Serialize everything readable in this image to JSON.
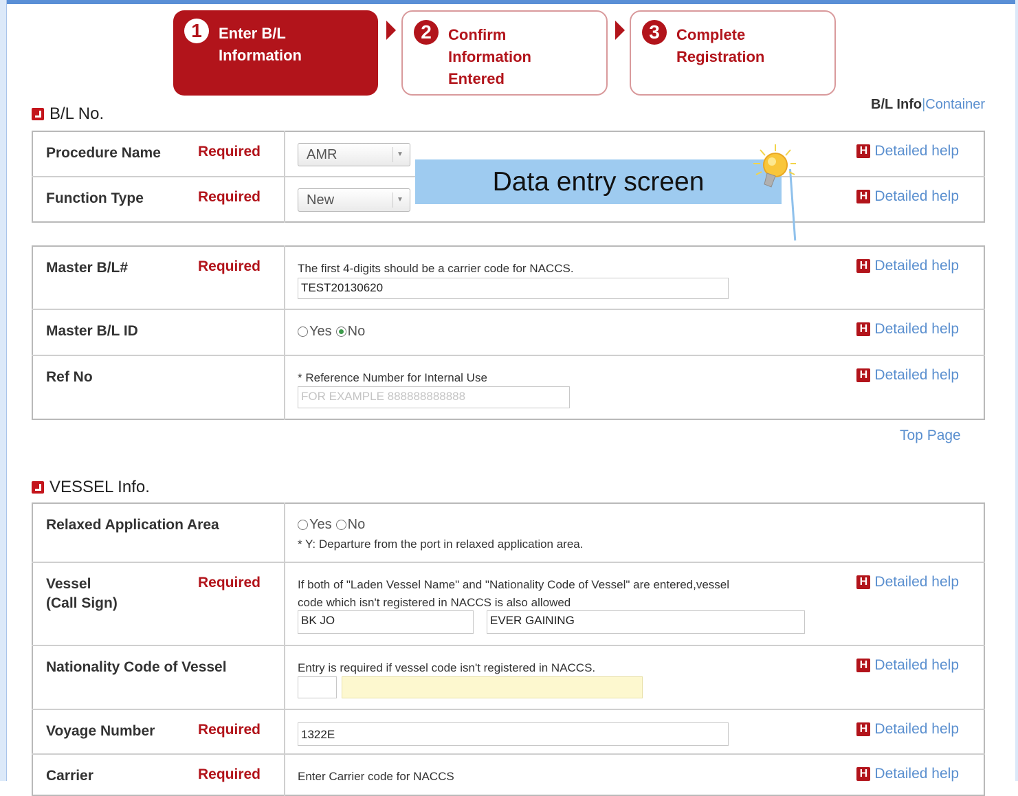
{
  "steps": [
    {
      "num": "1",
      "label": "Enter B/L\nInformation",
      "active": true
    },
    {
      "num": "2",
      "label": "Confirm\nInformation\nEntered",
      "active": false
    },
    {
      "num": "3",
      "label": "Complete\nRegistration",
      "active": false
    }
  ],
  "top_links": {
    "current": "B/L Info",
    "separator": "|",
    "other": "Container"
  },
  "sections": {
    "bl": {
      "title": "B/L No."
    },
    "vessel": {
      "title": "VESSEL Info."
    }
  },
  "common": {
    "required": "Required",
    "help": "Detailed help",
    "help_icon": "H",
    "top_page": "Top Page"
  },
  "bl_rows": {
    "procedure": {
      "label": "Procedure Name",
      "value": "AMR"
    },
    "function": {
      "label": "Function Type",
      "value": "New"
    },
    "master_bl": {
      "label": "Master B/L#",
      "note": "The first 4-digits should be a carrier code for NACCS.",
      "value": "TEST20130620"
    },
    "master_id": {
      "label": "Master B/L ID",
      "yes": "Yes",
      "no": "No",
      "selected": "No"
    },
    "ref_no": {
      "label": "Ref No",
      "note": "* Reference Number for Internal Use",
      "placeholder": "FOR EXAMPLE 888888888888"
    }
  },
  "vessel_rows": {
    "relaxed": {
      "label": "Relaxed Application Area",
      "yes": "Yes",
      "no": "No",
      "note": "* Y: Departure from the port in relaxed application area."
    },
    "vessel": {
      "label": "Vessel",
      "label2": "(Call Sign)",
      "note1": "If both of \"Laden Vessel Name\" and \"Nationality Code of Vessel\" are entered,vessel",
      "note2": "code which isn't registered in NACCS is also allowed",
      "call_sign": "BK JO",
      "name": "EVER GAINING"
    },
    "nationality": {
      "label": "Nationality Code of Vessel",
      "note": "Entry is required if vessel code isn't registered in NACCS."
    },
    "voyage": {
      "label": "Voyage Number",
      "value": "1322E"
    },
    "carrier": {
      "label": "Carrier",
      "note": "Enter Carrier code for NACCS"
    }
  },
  "callout": {
    "text": "Data entry screen"
  },
  "colors": {
    "accent": "#b2141b",
    "link": "#5a8fcf",
    "callout_bg": "#9ecbf0",
    "frame": "#5a8fd6"
  }
}
